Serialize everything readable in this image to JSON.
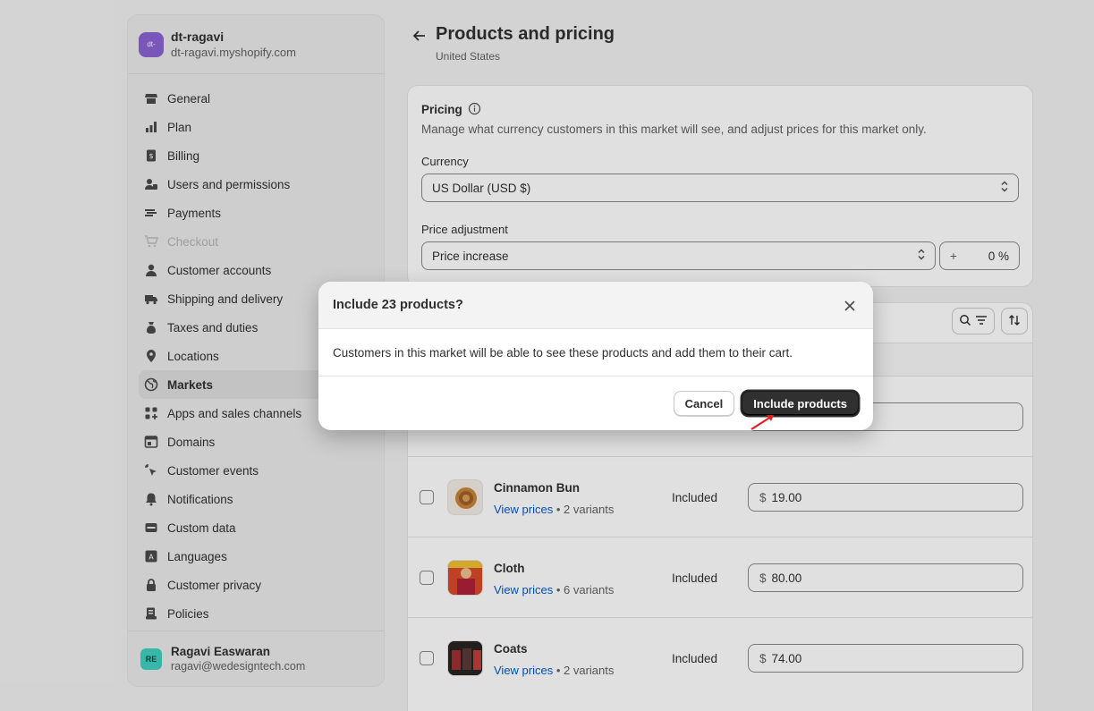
{
  "store": {
    "avatar": "dt-",
    "name": "dt-ragavi",
    "url": "dt-ragavi.myshopify.com"
  },
  "sidebar": {
    "items": [
      {
        "label": "General",
        "icon": "store-icon"
      },
      {
        "label": "Plan",
        "icon": "plan-icon"
      },
      {
        "label": "Billing",
        "icon": "billing-icon"
      },
      {
        "label": "Users and permissions",
        "icon": "users-icon"
      },
      {
        "label": "Payments",
        "icon": "payments-icon"
      },
      {
        "label": "Checkout",
        "icon": "cart-icon"
      },
      {
        "label": "Customer accounts",
        "icon": "person-icon"
      },
      {
        "label": "Shipping and delivery",
        "icon": "truck-icon"
      },
      {
        "label": "Taxes and duties",
        "icon": "tax-icon"
      },
      {
        "label": "Locations",
        "icon": "location-icon"
      },
      {
        "label": "Markets",
        "icon": "globe-icon"
      },
      {
        "label": "Apps and sales channels",
        "icon": "apps-icon"
      },
      {
        "label": "Domains",
        "icon": "domains-icon"
      },
      {
        "label": "Customer events",
        "icon": "cursor-icon"
      },
      {
        "label": "Notifications",
        "icon": "bell-icon"
      },
      {
        "label": "Custom data",
        "icon": "data-icon"
      },
      {
        "label": "Languages",
        "icon": "language-icon"
      },
      {
        "label": "Customer privacy",
        "icon": "lock-icon"
      },
      {
        "label": "Policies",
        "icon": "policies-icon"
      }
    ]
  },
  "user": {
    "initials": "RE",
    "name": "Ragavi Easwaran",
    "email": "ragavi@wedesigntech.com"
  },
  "page": {
    "title": "Products and pricing",
    "subtitle": "United States"
  },
  "pricing": {
    "title": "Pricing",
    "description": "Manage what currency customers in this market will see, and adjust prices for this market only.",
    "currency_label": "Currency",
    "currency_value": "US Dollar (USD $)",
    "adjustment_label": "Price adjustment",
    "adjustment_value": "Price increase",
    "adjustment_sign": "+",
    "adjustment_amount": "0",
    "adjustment_unit": "%"
  },
  "products": [
    {
      "name": "Cinnamon Bun",
      "link": "View prices",
      "variants": " • 2 variants",
      "status": "Included",
      "currency": "$",
      "price": "19.00"
    },
    {
      "name": "Cloth",
      "link": "View prices",
      "variants": " • 6 variants",
      "status": "Included",
      "currency": "$",
      "price": "80.00"
    },
    {
      "name": "Coats",
      "link": "View prices",
      "variants": " • 2 variants",
      "status": "Included",
      "currency": "$",
      "price": "74.00"
    }
  ],
  "modal": {
    "title": "Include 23 products?",
    "body": "Customers in this market will be able to see these products and add them to their cart.",
    "cancel_label": "Cancel",
    "confirm_label": "Include products"
  },
  "colors": {
    "primary_button": "#303030",
    "link": "#005bd3",
    "annotation_arrow": "#e02020"
  }
}
